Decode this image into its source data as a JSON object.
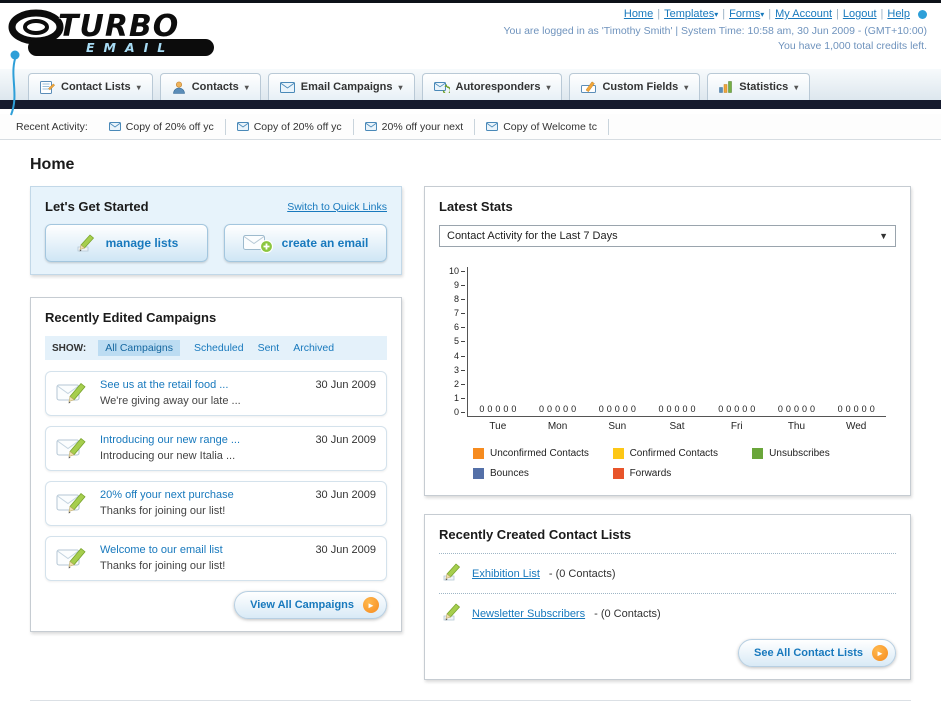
{
  "colors": {
    "link_blue": "#1879bd",
    "dark_bar": "#161b2e",
    "accent_orange": "#f68b1f",
    "panel_blue_bg": "#e7f3fb"
  },
  "header": {
    "logo_primary": "TURBO",
    "logo_secondary": "EMAIL",
    "nav_links": [
      {
        "label": "Home",
        "dropdown": false
      },
      {
        "label": "Templates",
        "dropdown": true
      },
      {
        "label": "Forms",
        "dropdown": true
      },
      {
        "label": "My Account",
        "dropdown": false
      },
      {
        "label": "Logout",
        "dropdown": false
      },
      {
        "label": "Help",
        "dropdown": false
      }
    ],
    "login_info": "You are logged in as 'Timothy Smith' | System Time: 10:58 am, 30 Jun 2009 - (GMT+10:00)",
    "credits_info": "You have 1,000 total credits left."
  },
  "nav_tabs": [
    {
      "label": "Contact Lists",
      "icon": "contact-lists-icon"
    },
    {
      "label": "Contacts",
      "icon": "contacts-icon"
    },
    {
      "label": "Email Campaigns",
      "icon": "email-campaigns-icon"
    },
    {
      "label": "Autoresponders",
      "icon": "autoresponders-icon"
    },
    {
      "label": "Custom Fields",
      "icon": "custom-fields-icon"
    },
    {
      "label": "Statistics",
      "icon": "statistics-icon"
    }
  ],
  "recent_activity": {
    "label": "Recent Activity:",
    "items": [
      "Copy of 20% off yc",
      "Copy of 20% off yc",
      "20% off your next",
      "Copy of Welcome tc"
    ]
  },
  "page_title": "Home",
  "get_started": {
    "title": "Let's Get Started",
    "switch_link": "Switch to Quick Links",
    "manage_lists_label": "manage lists",
    "create_email_label": "create an email"
  },
  "campaigns": {
    "title": "Recently Edited Campaigns",
    "show_label": "SHOW:",
    "filters": [
      {
        "label": "All Campaigns",
        "selected": true
      },
      {
        "label": "Scheduled",
        "selected": false
      },
      {
        "label": "Sent",
        "selected": false
      },
      {
        "label": "Archived",
        "selected": false
      }
    ],
    "items": [
      {
        "title": "See us at the retail food ...",
        "subtitle": "We're giving away our late ...",
        "date": "30 Jun 2009"
      },
      {
        "title": "Introducing our new range ...",
        "subtitle": "Introducing our new Italia ...",
        "date": "30 Jun 2009"
      },
      {
        "title": "20% off your next purchase",
        "subtitle": "Thanks for joining our list!",
        "date": "30 Jun 2009"
      },
      {
        "title": "Welcome to our email list",
        "subtitle": "Thanks for joining our list!",
        "date": "30 Jun 2009"
      }
    ],
    "view_all_label": "View All Campaigns"
  },
  "stats": {
    "title": "Latest Stats",
    "period_selected": "Contact Activity for the Last 7 Days"
  },
  "chart_data": {
    "type": "bar",
    "title": "Contact Activity for the Last 7 Days",
    "categories": [
      "Tue",
      "Mon",
      "Sun",
      "Sat",
      "Fri",
      "Thu",
      "Wed"
    ],
    "series": [
      {
        "name": "Unconfirmed Contacts",
        "color": "#f68b1f",
        "values": [
          0,
          0,
          0,
          0,
          0,
          0,
          0
        ]
      },
      {
        "name": "Confirmed Contacts",
        "color": "#fdc716",
        "values": [
          0,
          0,
          0,
          0,
          0,
          0,
          0
        ]
      },
      {
        "name": "Unsubscribes",
        "color": "#6aa63a",
        "values": [
          0,
          0,
          0,
          0,
          0,
          0,
          0
        ]
      },
      {
        "name": "Bounces",
        "color": "#5470a8",
        "values": [
          0,
          0,
          0,
          0,
          0,
          0,
          0
        ]
      },
      {
        "name": "Forwards",
        "color": "#e8542a",
        "values": [
          0,
          0,
          0,
          0,
          0,
          0,
          0
        ]
      }
    ],
    "ylim": [
      0,
      10
    ],
    "yticks": [
      0,
      1,
      2,
      3,
      4,
      5,
      6,
      7,
      8,
      9,
      10
    ],
    "grid": false,
    "legend_position": "bottom",
    "value_labels_shown": true
  },
  "contact_lists": {
    "title": "Recently Created Contact Lists",
    "items": [
      {
        "name": "Exhibition List",
        "suffix": "- (0 Contacts)"
      },
      {
        "name": "Newsletter Subscribers",
        "suffix": "- (0 Contacts)"
      }
    ],
    "see_all_label": "See All Contact Lists"
  }
}
